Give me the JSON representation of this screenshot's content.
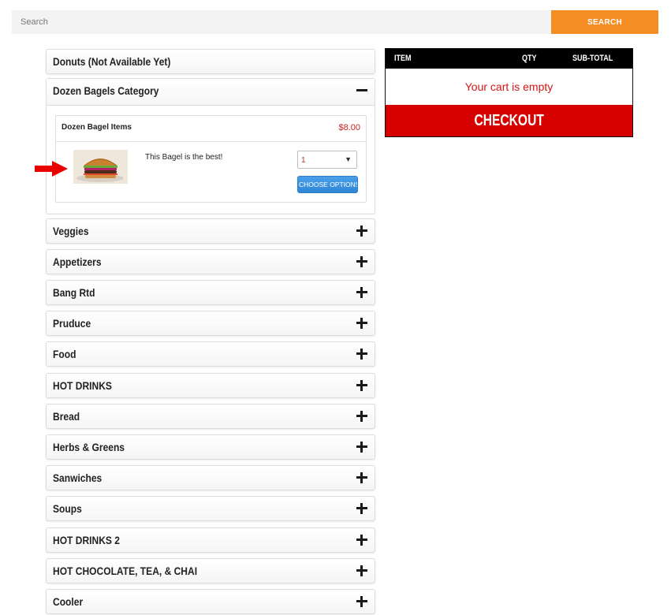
{
  "search": {
    "placeholder": "Search",
    "button_label": "SEARCH"
  },
  "categories": [
    {
      "label": "Donuts (Not Available Yet)"
    },
    {
      "label": "Dozen Bagels Category",
      "expanded": true
    },
    {
      "label": "Veggies"
    },
    {
      "label": "Appetizers"
    },
    {
      "label": "Bang Rtd"
    },
    {
      "label": "Pruduce"
    },
    {
      "label": "Food"
    },
    {
      "label": "HOT DRINKS"
    },
    {
      "label": "Bread"
    },
    {
      "label": "Herbs & Greens"
    },
    {
      "label": "Sanwiches"
    },
    {
      "label": "Soups"
    },
    {
      "label": "HOT DRINKS 2"
    },
    {
      "label": "HOT CHOCOLATE, TEA, & CHAI"
    },
    {
      "label": "Cooler"
    }
  ],
  "item": {
    "title": "Dozen Bagel Items",
    "price": "$8.00",
    "description": "This Bagel is the best!",
    "quantity": "1",
    "options_button": "CHOOSE OPTIONS",
    "image": "burger-bagel-photo"
  },
  "cart": {
    "col_item": "ITEM",
    "col_qty": "QTY",
    "col_subtotal": "SUB-TOTAL",
    "empty_message": "Your cart is empty",
    "checkout_label": "CHECKOUT"
  },
  "colors": {
    "search_button": "#f58d25",
    "price": "#d02020",
    "checkout": "#d60000",
    "choose_options": "#2f86d6",
    "arrow": "#e80000"
  }
}
